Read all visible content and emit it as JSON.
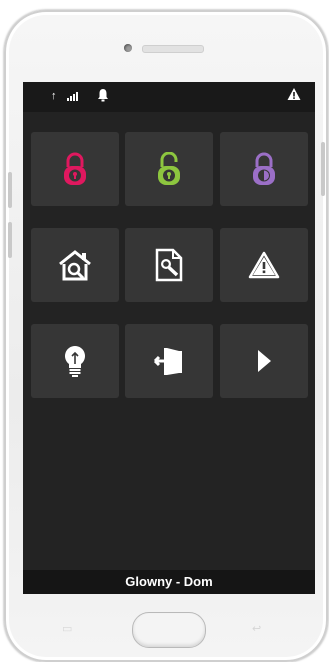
{
  "device": {
    "model": "white smartphone"
  },
  "status_bar": {
    "icons": [
      "upload-arrow-icon",
      "signal-bars-icon",
      "notification-bell-icon",
      "warning-triangle-icon"
    ],
    "arrow_glyph": "↑"
  },
  "grid": {
    "tiles": [
      {
        "name": "lock-red-tile",
        "icon": "padlock-locked-icon",
        "color": "#e0185f"
      },
      {
        "name": "lock-green-tile",
        "icon": "padlock-unlocked-icon",
        "color": "#8dc63f"
      },
      {
        "name": "lock-purple-tile",
        "icon": "padlock-partial-icon",
        "color": "#9b6fc7"
      },
      {
        "name": "home-search-tile",
        "icon": "house-magnifier-icon",
        "color": "#ffffff"
      },
      {
        "name": "document-search-tile",
        "icon": "document-magnifier-icon",
        "color": "#ffffff"
      },
      {
        "name": "alert-tile",
        "icon": "warning-triangle-icon",
        "color": "#ffffff"
      },
      {
        "name": "lightbulb-tile",
        "icon": "lightbulb-icon",
        "color": "#ffffff"
      },
      {
        "name": "exit-door-tile",
        "icon": "exit-door-icon",
        "color": "#ffffff"
      },
      {
        "name": "next-tile",
        "icon": "play-right-icon",
        "color": "#ffffff"
      }
    ]
  },
  "footer": {
    "title": "Glowny - Dom"
  },
  "nav_keys": {
    "recent": "▭",
    "back": "↩"
  }
}
